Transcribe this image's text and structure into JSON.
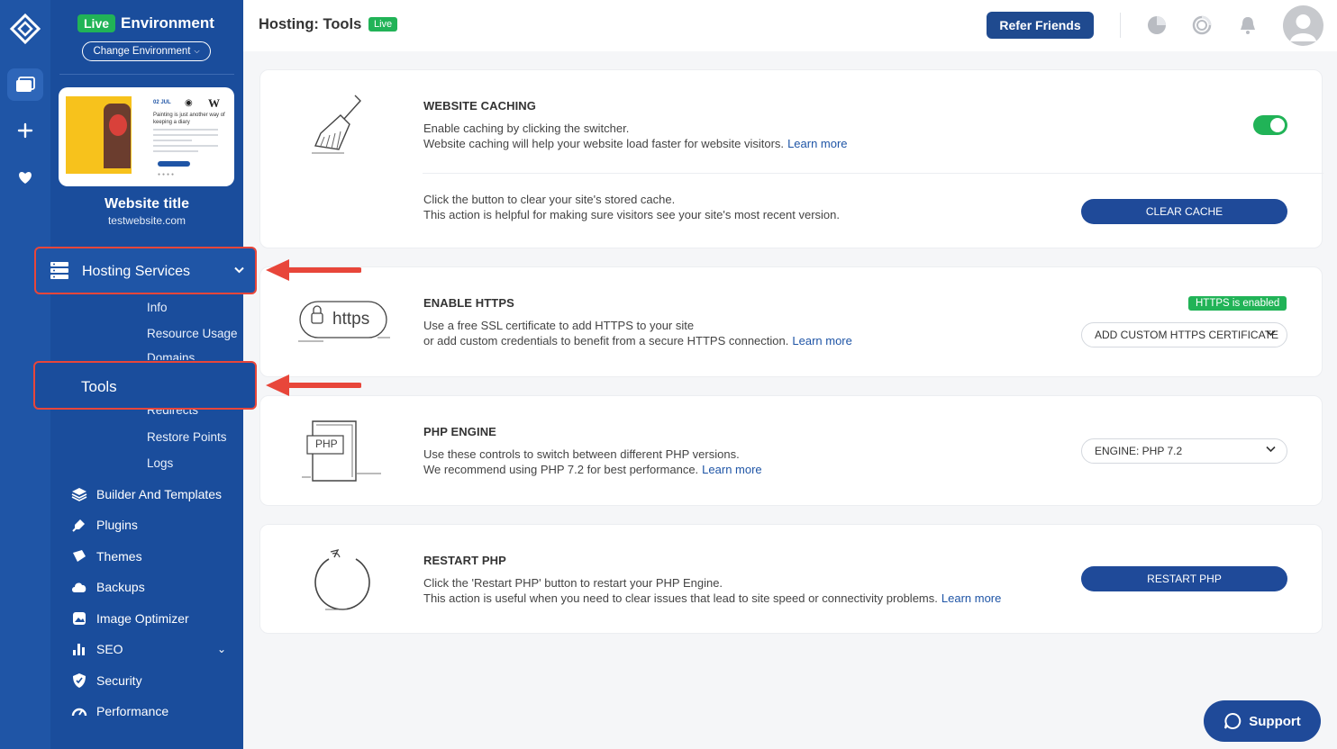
{
  "sidebar": {
    "env_badge": "Live",
    "env_label": "Environment",
    "change_env": "Change Environment",
    "thumb": {
      "date": "02 JUL",
      "heading": "Painting is just another way of keeping a diary"
    },
    "site_title": "Website title",
    "site_url": "testwebsite.com",
    "hosting_services": "Hosting Services",
    "sub_items": [
      "Info",
      "Resource Usage",
      "Domains",
      "Tools",
      "Redirects",
      "Restore Points",
      "Logs"
    ],
    "menu": [
      "Builder And Templates",
      "Plugins",
      "Themes",
      "Backups",
      "Image Optimizer",
      "SEO",
      "Security",
      "Performance"
    ]
  },
  "header": {
    "title": "Hosting: Tools",
    "badge": "Live",
    "refer": "Refer Friends"
  },
  "cards": {
    "caching": {
      "title": "WEBSITE CACHING",
      "line1": "Enable caching by clicking the switcher.",
      "line2": "Website caching will help your website load faster for website visitors.",
      "learn": "Learn more",
      "clear_line1": "Click the button to clear your site's stored cache.",
      "clear_line2": "This action is helpful for making sure visitors see your site's most recent version.",
      "button": "CLEAR CACHE"
    },
    "https": {
      "title": "ENABLE HTTPS",
      "line1": "Use a free SSL certificate to add HTTPS to your site",
      "line2": "or add custom credentials to benefit from a secure HTTPS connection.",
      "learn": "Learn more",
      "badge": "HTTPS is enabled",
      "button": "ADD CUSTOM HTTPS CERTIFICATE",
      "illus_text": "https"
    },
    "php": {
      "title": "PHP ENGINE",
      "line1": "Use these controls to switch between different PHP versions.",
      "line2": "We recommend using PHP 7.2 for best performance.",
      "learn": "Learn more",
      "select": "ENGINE: PHP 7.2",
      "illus_text": "PHP"
    },
    "restart": {
      "title": "RESTART PHP",
      "line1": "Click the 'Restart PHP' button to restart your PHP Engine.",
      "line2": "This action is useful when you need to clear issues that lead to site speed or connectivity problems.",
      "learn": "Learn more",
      "button": "RESTART PHP"
    }
  },
  "support": "Support",
  "colors": {
    "brand": "#1f55a6",
    "accent_green": "#21b357",
    "highlight_red": "#e8463a"
  }
}
